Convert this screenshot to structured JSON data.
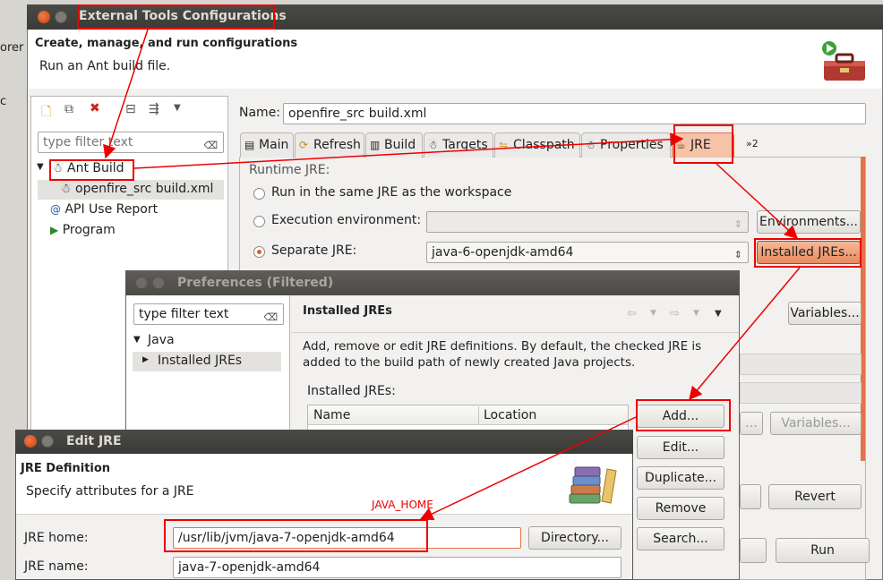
{
  "back_edge": {
    "left_text_1": "orer",
    "left_text_2": "c"
  },
  "ext_tools": {
    "title": "External Tools Configurations",
    "header_title": "Create, manage, and run configurations",
    "header_subtitle": "Run an Ant build file.",
    "filter_placeholder": "type filter text",
    "tree": {
      "ant_build": "Ant Build",
      "openfire_item": "openfire_src build.xml",
      "api_use_report": "API Use Report",
      "program": "Program"
    },
    "name_label": "Name:",
    "name_value": "openfire_src build.xml",
    "tabs": [
      "Main",
      "Refresh",
      "Build",
      "Targets",
      "Classpath",
      "Properties",
      "JRE"
    ],
    "tabs_more": "»2",
    "runtime_jre_label": "Runtime JRE:",
    "radio_same_jre": "Run in the same JRE as the workspace",
    "radio_exec_env": "Execution environment:",
    "radio_separate": "Separate JRE:",
    "separate_jre_value": "java-6-openjdk-amd64",
    "environments_btn": "Environments...",
    "installed_jres_btn": "Installed JREs...",
    "variables_btn": "Variables...",
    "variables_btn2": "Variables...",
    "revert_btn": "Revert",
    "run_btn": "Run"
  },
  "preferences": {
    "title": "Preferences (Filtered)",
    "filter_value": "type filter text",
    "tree": {
      "java": "Java",
      "installed_jres": "Installed JREs"
    },
    "page_title": "Installed JREs",
    "description": "Add, remove or edit JRE definitions. By default, the checked JRE is added to the build path of newly created Java projects.",
    "installed_label": "Installed JREs:",
    "columns": [
      "Name",
      "Location"
    ],
    "buttons": {
      "add": "Add...",
      "edit": "Edit...",
      "duplicate": "Duplicate...",
      "remove": "Remove",
      "search": "Search..."
    }
  },
  "edit_jre": {
    "title": "Edit JRE",
    "section_title": "JRE Definition",
    "section_subtitle": "Specify attributes for a JRE",
    "jre_home_label": "JRE home:",
    "jre_home_value": "/usr/lib/jvm/java-7-openjdk-amd64",
    "directory_btn": "Directory...",
    "jre_name_label": "JRE name:",
    "jre_name_value": "java-7-openjdk-amd64"
  },
  "annotation": {
    "java_home": "JAVA_HOME"
  },
  "colors": {
    "annotation_red": "#ee0000",
    "titlebar": "#3c3b37",
    "accent_orange": "#e2734a"
  }
}
